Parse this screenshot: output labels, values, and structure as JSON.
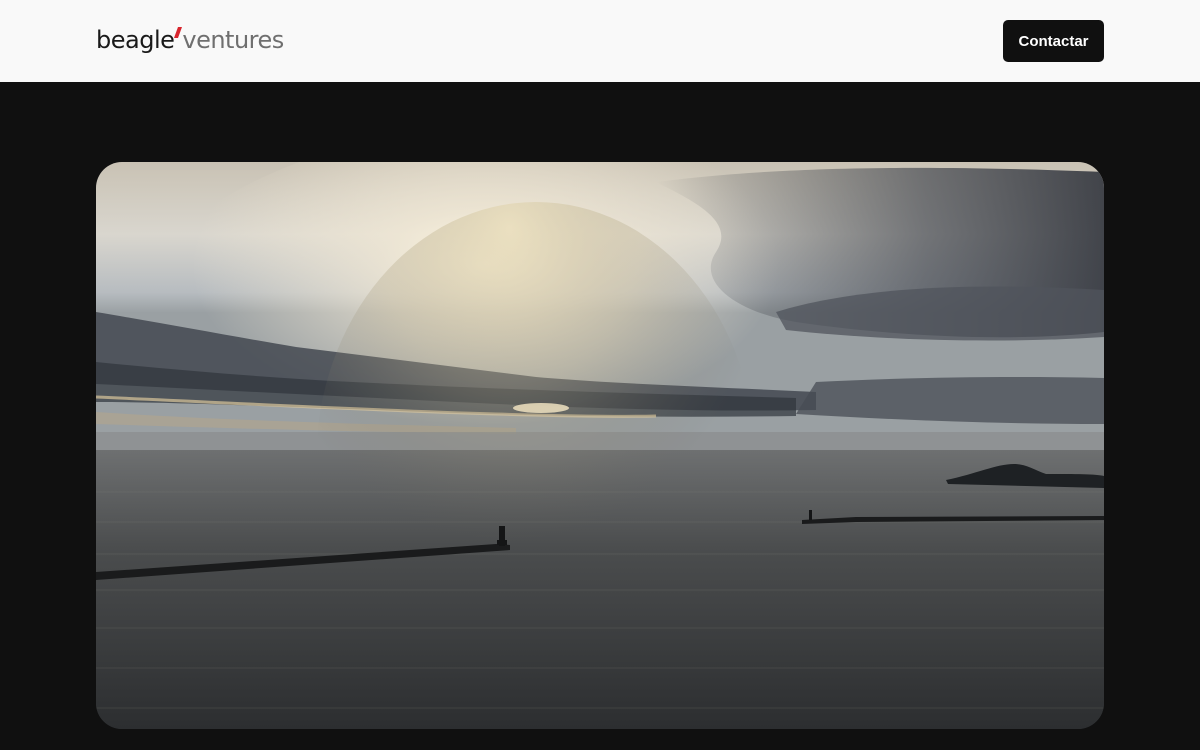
{
  "header": {
    "logo": {
      "part1": "beagle",
      "part2": "ventures",
      "accent_color": "#d8262e"
    },
    "contact_label": "Contactar"
  },
  "hero": {
    "media": "sunset-over-lake-image",
    "colors": {
      "sky_top": "#9fb3c4",
      "sun_glow": "#fff4d6",
      "cloud_dark": "#4a4f57",
      "water": "#3a3d40"
    }
  }
}
